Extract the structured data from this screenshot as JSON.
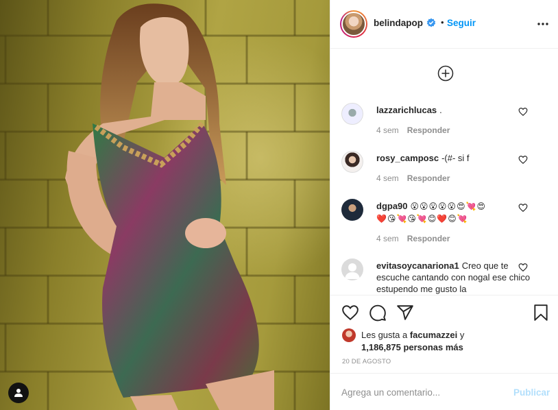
{
  "post": {
    "author": "belindapop",
    "follow_label": "Seguir",
    "dot": "•"
  },
  "comments": [
    {
      "user": "lazzarichlucas",
      "text": ".",
      "time": "4 sem",
      "reply": "Responder"
    },
    {
      "user": "rosy_camposc",
      "text": "-(#- si f",
      "time": "4 sem",
      "reply": "Responder"
    },
    {
      "user": "dgpa90",
      "text": "😮😮😮😮😮😍💘😍",
      "text2": "❤️😘💘😘💘😊❤️😊💘",
      "time": "4 sem",
      "reply": "Responder"
    },
    {
      "user": "evitasoycanariona1",
      "text": "Creo que te escuche cantando con nogal ese chico estupendo me gusto la"
    }
  ],
  "likes": {
    "prefix": "Les gusta a",
    "user": "facumazzei",
    "connector": "y",
    "count": "1,186,875 personas más"
  },
  "date": "20 DE AGOSTO",
  "add_comment": {
    "placeholder": "Agrega un comentario...",
    "publish_label": "Publicar"
  },
  "colors": {
    "accent": "#0095f6",
    "publish_disabled": "#b2dffc",
    "muted": "#8e8e8e",
    "text": "#262626"
  }
}
